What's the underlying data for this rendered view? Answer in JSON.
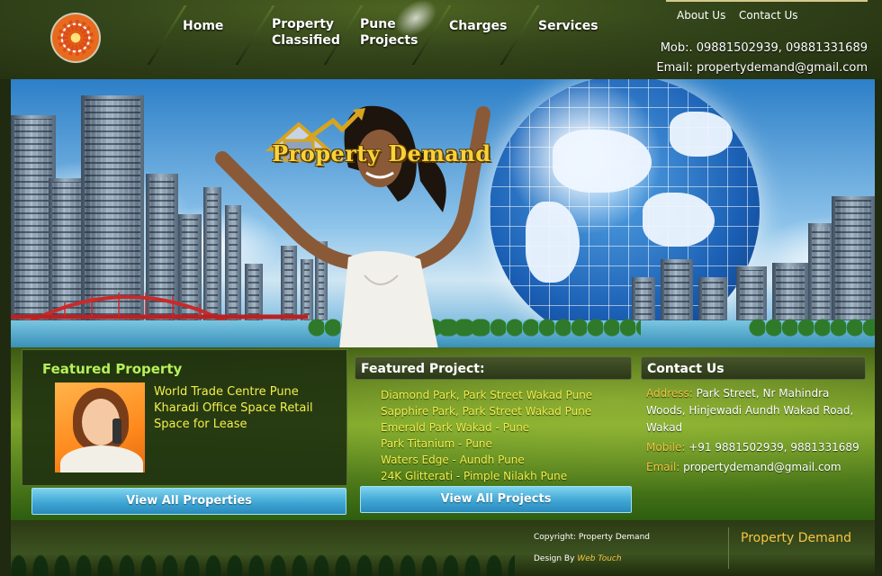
{
  "header": {
    "nav": [
      {
        "label": "Home"
      },
      {
        "label": "Property\nClassified"
      },
      {
        "label": "Pune\nProjects"
      },
      {
        "label": "Charges"
      },
      {
        "label": "Services"
      }
    ],
    "top_links": {
      "about": "About Us",
      "contact": "Contact Us"
    },
    "mobile": "Mob:. 09881502939, 09881331689",
    "email": "Email: propertydemand@gmail.com"
  },
  "banner": {
    "brand": "Property Demand"
  },
  "featured_property": {
    "title": "Featured Property",
    "text": "World Trade Centre Pune Kharadi Office Space Retail Space for Lease",
    "button": "View All Properties"
  },
  "featured_project": {
    "title": "Featured Project:",
    "items": [
      "Diamond Park, Park Street Wakad Pune",
      "Sapphire Park, Park Street Wakad Pune",
      "Emerald Park Wakad - Pune",
      "Park Titanium - Pune",
      "Waters Edge - Aundh Pune",
      "24K Glitterati - Pimple Nilakh Pune"
    ],
    "button": "View All Projects"
  },
  "contact": {
    "title": "Contact Us",
    "address_label": "Address:",
    "address": "Park Street, Nr Mahindra Woods, Hinjewadi Aundh Wakad Road, Wakad",
    "mobile_label": "Mobile:",
    "mobile": "+91 9881502939, 9881331689",
    "email_label": "Email:",
    "email": "propertydemand@gmail.com"
  },
  "footer": {
    "copyright": "Copyright: Property Demand",
    "design_by": "Design By",
    "designer": "Web Touch",
    "brand": "Property Demand"
  },
  "colors": {
    "accent_yellow": "#f4ef4a",
    "label_orange": "#f5c542",
    "button_blue": "#3fa6d4",
    "header_green": "#33451a"
  }
}
